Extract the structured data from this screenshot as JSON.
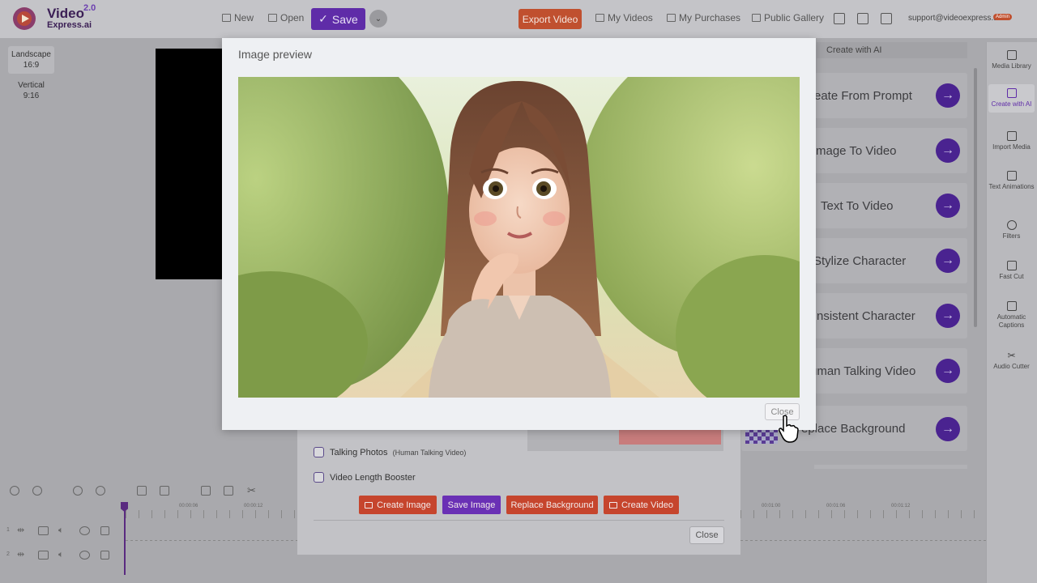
{
  "header": {
    "logo_line1": "Video",
    "logo_line2": "Express.ai",
    "logo_version": "2.0",
    "new_label": "New",
    "open_label": "Open",
    "save_label": "Save",
    "export_label": "Export Video",
    "my_videos_label": "My Videos",
    "my_purchases_label": "My Purchases",
    "public_gallery_label": "Public Gallery",
    "email": "support@videoexpress.ai",
    "admin_badge": "Admin"
  },
  "aspect": [
    {
      "name": "Landscape",
      "ratio": "16:9"
    },
    {
      "name": "Vertical",
      "ratio": "9:16"
    }
  ],
  "right_panel": {
    "title": "Create with AI",
    "items": [
      "reate From Prompt",
      "mage To Video",
      "Text To Video",
      "Stylize Character",
      "nsistent Character",
      "uman Talking Video",
      "eplace Background"
    ]
  },
  "sidebar": [
    {
      "label": "Media Library",
      "icon": "media-library-icon"
    },
    {
      "label": "Create with AI",
      "icon": "robot-icon"
    },
    {
      "label": "Import Media",
      "icon": "import-icon"
    },
    {
      "label": "Text Animations",
      "icon": "film-icon"
    },
    {
      "label": "Filters",
      "icon": "filter-icon"
    },
    {
      "label": "Fast Cut",
      "icon": "fast-cut-icon"
    },
    {
      "label": "Automatic Captions",
      "icon": "captions-icon"
    },
    {
      "label": "Audio Cutter",
      "icon": "scissors-icon"
    }
  ],
  "timeline": {
    "ticks_left": [
      "00:00:06",
      "00:00:12"
    ],
    "ticks_right": [
      "00:01:00",
      "00:01:06",
      "00:01:12"
    ],
    "tracks": [
      "1",
      "2"
    ]
  },
  "dialog2": {
    "opt_talking": "Talking Photos",
    "opt_talking_sub": "(Human Talking Video)",
    "opt_booster": "Video Length Booster",
    "btn_create_image": "Create Image",
    "btn_save_image": "Save Image",
    "btn_replace_bg": "Replace Background",
    "btn_create_video": "Create Video",
    "close_label": "Close"
  },
  "modal": {
    "title": "Image preview",
    "close_label": "Close"
  },
  "colors": {
    "accent": "#5f2ca8",
    "export": "#c0502f"
  }
}
